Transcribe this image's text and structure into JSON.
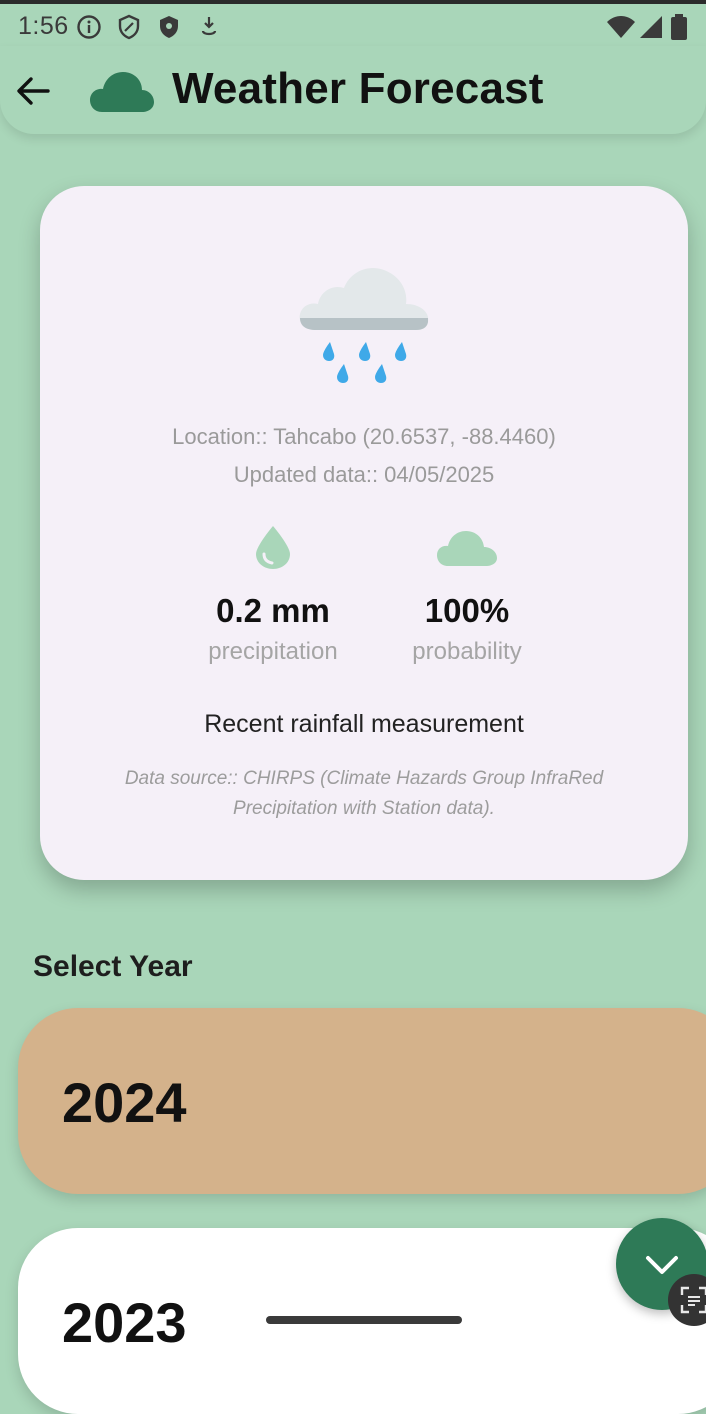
{
  "status_bar": {
    "time": "1:56",
    "icons": [
      "info-icon",
      "shield-outline-icon",
      "shield-filled-icon",
      "download-icon",
      "wifi-icon",
      "signal-icon",
      "battery-icon"
    ]
  },
  "app_bar": {
    "back_icon": "arrow-left-icon",
    "logo_icon": "cloud-icon",
    "title": "Weather Forecast"
  },
  "weather_card": {
    "condition_icon": "cloud-rain-icon",
    "location": "Location:: Tahcabo (20.6537, -88.4460)",
    "updated": "Updated data:: 04/05/2025",
    "precipitation": {
      "icon": "droplet-icon",
      "value": "0.2 mm",
      "label": "precipitation"
    },
    "probability": {
      "icon": "cloud-icon",
      "value": "100%",
      "label": "probability"
    },
    "caption": "Recent rainfall measurement",
    "source": "Data source:: CHIRPS (Climate Hazards Group InfraRed Precipitation with Station data)."
  },
  "year_section": {
    "heading": "Select Year",
    "years": [
      "2024",
      "2023"
    ]
  },
  "fab": {
    "icon": "chevron-down-icon"
  },
  "colors": {
    "background": "#a9d6b9",
    "card": "#f5f0f8",
    "accent": "#2e7a57",
    "year_selected": "#d4b28b",
    "icon_green": "#a9d6b9"
  }
}
